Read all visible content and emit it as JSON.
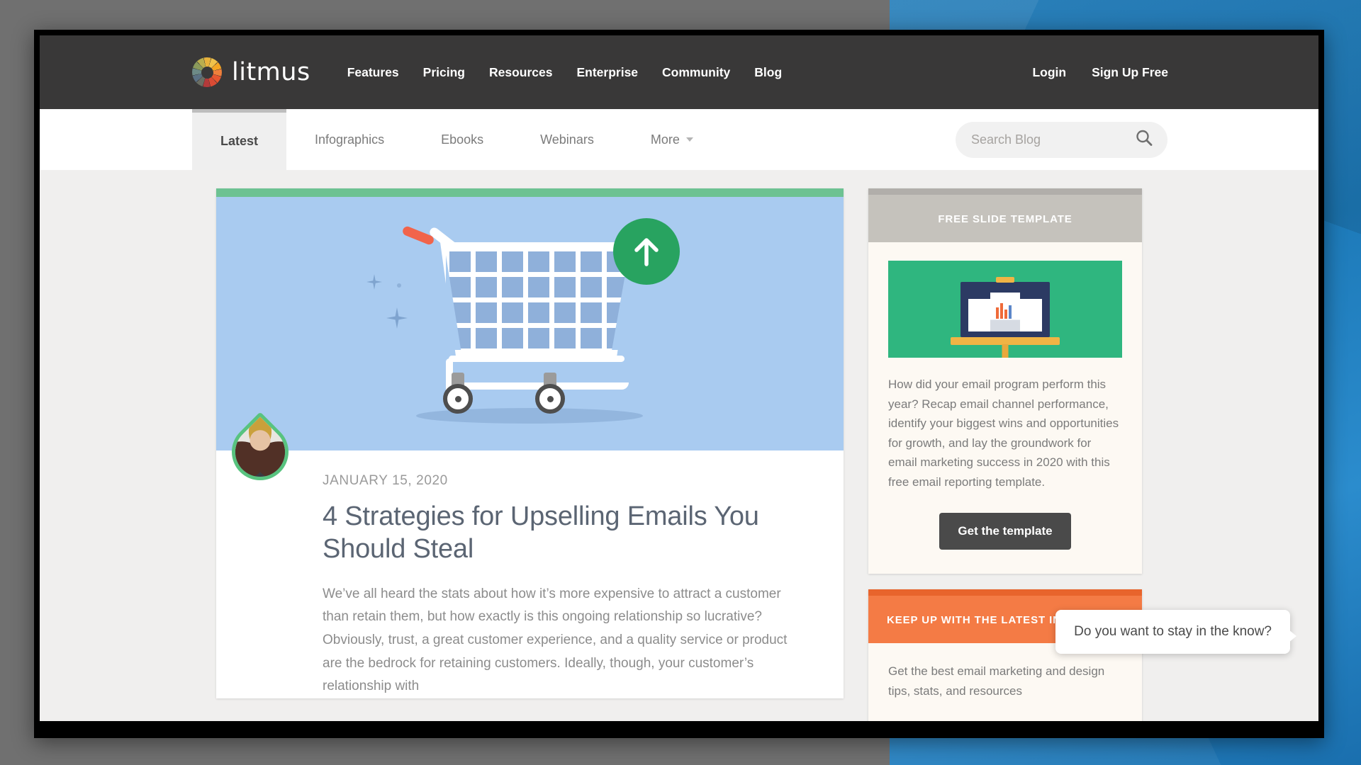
{
  "site": {
    "logo_text": "litmus",
    "logo_icon": "litmus-color-wheel-icon"
  },
  "main_nav": [
    {
      "label": "Features"
    },
    {
      "label": "Pricing"
    },
    {
      "label": "Resources"
    },
    {
      "label": "Enterprise"
    },
    {
      "label": "Community"
    },
    {
      "label": "Blog"
    }
  ],
  "auth_nav": {
    "login": "Login",
    "signup": "Sign Up Free"
  },
  "blog_tabs": [
    {
      "label": "Latest",
      "active": true
    },
    {
      "label": "Infographics",
      "active": false
    },
    {
      "label": "Ebooks",
      "active": false
    },
    {
      "label": "Webinars",
      "active": false
    },
    {
      "label": "More",
      "active": false,
      "has_caret": true
    }
  ],
  "search": {
    "placeholder": "Search Blog",
    "value": "",
    "icon": "search-icon"
  },
  "article": {
    "date": "JANUARY 15, 2020",
    "title": "4 Strategies for Upselling Emails You Should Steal",
    "excerpt": "We’ve all heard the stats about how it’s more expensive to attract a customer than retain them, but how exactly is this ongoing relationship so lucrative? Obviously, trust, a great customer experience, and a quality service or product are the bedrock for retaining customers. Ideally, though, your customer’s relationship with",
    "hero_alt": "shopping-cart-with-up-arrow-illustration",
    "author_avatar": "author-avatar"
  },
  "sidebar": {
    "slide_widget": {
      "heading": "FREE SLIDE TEMPLATE",
      "thumb_alt": "presentation-screen-illustration",
      "description": "How did your email program perform this year? Recap email channel performance, identify your biggest wins and opportunities for growth, and lay the groundwork for email marketing success in 2020 with this free email reporting template.",
      "cta_label": "Get the template"
    },
    "news_widget": {
      "heading": "KEEP UP WITH THE LATEST IN EMAIL",
      "description": "Get the best email marketing and design tips, stats, and resources"
    }
  },
  "chat_bubble": {
    "message": "Do you want to stay in the know?"
  },
  "colors": {
    "header_bg": "#393838",
    "page_bg": "#f0efee",
    "article_accent": "#6dc292",
    "hero_bg": "#a9cbf0",
    "badge_green": "#28a360",
    "cart_handle_red": "#f1644b",
    "slide_head_gray": "#c5c2bc",
    "news_head_orange": "#f47b45",
    "cta_dark": "#4a4a4a",
    "slide_thumb_green": "#2fb67f"
  }
}
